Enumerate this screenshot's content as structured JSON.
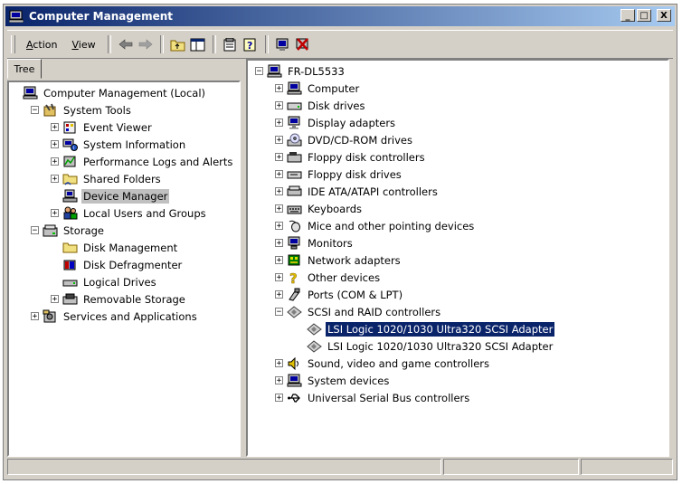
{
  "window": {
    "title": "Computer Management"
  },
  "title_buttons": [
    "_",
    "□",
    "X"
  ],
  "menu": [
    {
      "label": "Action",
      "key": "A",
      "rest": "ction"
    },
    {
      "label": "View",
      "key": "V",
      "rest": "iew"
    }
  ],
  "toolbar_icons": [
    "back-arrow-icon",
    "forward-arrow-icon",
    "up-folder-icon",
    "show-hide-tree-icon",
    "properties-icon",
    "help-icon",
    "scan-hardware-icon",
    "uninstall-icon"
  ],
  "left_tab": "Tree",
  "left_tree": [
    {
      "label": "Computer Management (Local)",
      "icon": "computer-icon",
      "exp": "",
      "indent": 0
    },
    {
      "label": "System Tools",
      "icon": "tools-icon",
      "exp": "−",
      "indent": 1
    },
    {
      "label": "Event Viewer",
      "icon": "event-viewer-icon",
      "exp": "+",
      "indent": 2
    },
    {
      "label": "System Information",
      "icon": "system-info-icon",
      "exp": "+",
      "indent": 2
    },
    {
      "label": "Performance Logs and Alerts",
      "icon": "performance-icon",
      "exp": "+",
      "indent": 2
    },
    {
      "label": "Shared Folders",
      "icon": "shared-folder-icon",
      "exp": "+",
      "indent": 2
    },
    {
      "label": "Device Manager",
      "icon": "device-manager-icon",
      "exp": "",
      "indent": 2,
      "selected": true
    },
    {
      "label": "Local Users and Groups",
      "icon": "users-icon",
      "exp": "+",
      "indent": 2
    },
    {
      "label": "Storage",
      "icon": "storage-icon",
      "exp": "−",
      "indent": 1
    },
    {
      "label": "Disk Management",
      "icon": "disk-management-icon",
      "exp": "",
      "indent": 2
    },
    {
      "label": "Disk Defragmenter",
      "icon": "defragmenter-icon",
      "exp": "",
      "indent": 2
    },
    {
      "label": "Logical Drives",
      "icon": "logical-drives-icon",
      "exp": "",
      "indent": 2
    },
    {
      "label": "Removable Storage",
      "icon": "removable-storage-icon",
      "exp": "+",
      "indent": 2
    },
    {
      "label": "Services and Applications",
      "icon": "services-icon",
      "exp": "+",
      "indent": 1
    }
  ],
  "right_tree": [
    {
      "label": "FR-DL5533",
      "icon": "computer-icon",
      "exp": "−",
      "indent": 0
    },
    {
      "label": "Computer",
      "icon": "computer-icon",
      "exp": "+",
      "indent": 1
    },
    {
      "label": "Disk drives",
      "icon": "disk-drive-icon",
      "exp": "+",
      "indent": 1
    },
    {
      "label": "Display adapters",
      "icon": "display-icon",
      "exp": "+",
      "indent": 1
    },
    {
      "label": "DVD/CD-ROM drives",
      "icon": "cdrom-icon",
      "exp": "+",
      "indent": 1
    },
    {
      "label": "Floppy disk controllers",
      "icon": "floppy-controller-icon",
      "exp": "+",
      "indent": 1
    },
    {
      "label": "Floppy disk drives",
      "icon": "floppy-drive-icon",
      "exp": "+",
      "indent": 1
    },
    {
      "label": "IDE ATA/ATAPI controllers",
      "icon": "ide-controller-icon",
      "exp": "+",
      "indent": 1
    },
    {
      "label": "Keyboards",
      "icon": "keyboard-icon",
      "exp": "+",
      "indent": 1
    },
    {
      "label": "Mice and other pointing devices",
      "icon": "mouse-icon",
      "exp": "+",
      "indent": 1
    },
    {
      "label": "Monitors",
      "icon": "monitor-icon",
      "exp": "+",
      "indent": 1
    },
    {
      "label": "Network adapters",
      "icon": "network-icon",
      "exp": "+",
      "indent": 1
    },
    {
      "label": "Other devices",
      "icon": "question-icon",
      "exp": "+",
      "indent": 1
    },
    {
      "label": "Ports (COM & LPT)",
      "icon": "port-icon",
      "exp": "+",
      "indent": 1
    },
    {
      "label": "SCSI and RAID controllers",
      "icon": "scsi-icon",
      "exp": "−",
      "indent": 1
    },
    {
      "label": "LSI Logic 1020/1030 Ultra320 SCSI Adapter",
      "icon": "scsi-icon",
      "exp": "",
      "indent": 2,
      "highlighted": true
    },
    {
      "label": "LSI Logic 1020/1030 Ultra320 SCSI Adapter",
      "icon": "scsi-icon",
      "exp": "",
      "indent": 2
    },
    {
      "label": "Sound, video and game controllers",
      "icon": "sound-icon",
      "exp": "+",
      "indent": 1
    },
    {
      "label": "System devices",
      "icon": "system-devices-icon",
      "exp": "+",
      "indent": 1
    },
    {
      "label": "Universal Serial Bus controllers",
      "icon": "usb-icon",
      "exp": "+",
      "indent": 1
    }
  ],
  "status_cells": [
    "",
    "",
    ""
  ],
  "colors": {
    "title_start": "#0a246a",
    "title_end": "#a6caf0",
    "selection": "#0a246a",
    "face": "#d4d0c8"
  }
}
